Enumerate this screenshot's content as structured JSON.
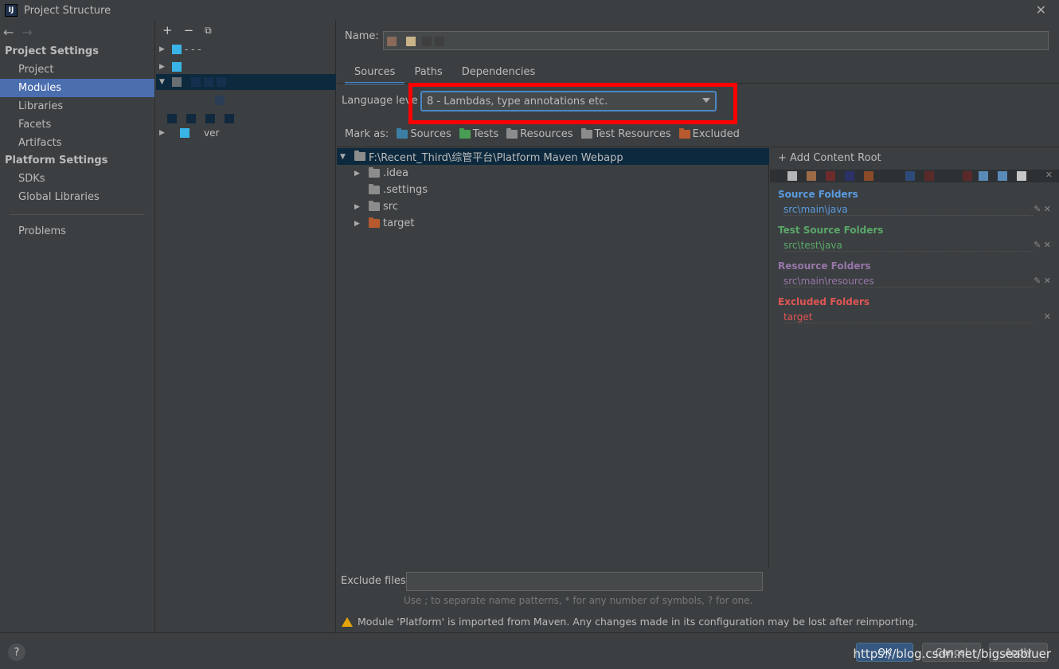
{
  "window": {
    "title": "Project Structure",
    "app_icon": "IJ"
  },
  "sidebar": {
    "back": "←",
    "forward": "→",
    "project_settings": "Project Settings",
    "project_items": [
      "Project",
      "Modules",
      "Libraries",
      "Facets",
      "Artifacts"
    ],
    "platform_settings": "Platform Settings",
    "platform_items": [
      "SDKs",
      "Global Libraries"
    ],
    "problems": "Problems",
    "selected": "Modules"
  },
  "modules": {
    "add": "+",
    "remove": "−",
    "copy": "⧉",
    "visible_text": [
      "- - -",
      "ver"
    ]
  },
  "name": {
    "label": "Name:",
    "value": ""
  },
  "tabs": [
    "Sources",
    "Paths",
    "Dependencies"
  ],
  "active_tab": "Sources",
  "language_level": {
    "label": "Language leve",
    "value": "8 - Lambdas, type annotations etc."
  },
  "mark_as": {
    "label": "Mark as:",
    "buttons": [
      {
        "label": "Sources",
        "color": "#3d7fa4"
      },
      {
        "label": "Tests",
        "color": "#499c54"
      },
      {
        "label": "Resources",
        "color": "#8c8c8c"
      },
      {
        "label": "Test Resources",
        "color": "#8c8c8c"
      },
      {
        "label": "Excluded",
        "color": "#b75a2d"
      }
    ]
  },
  "tree": {
    "root": "F:\\Recent_Third\\综管平台\\Platform Maven Webapp",
    "children": [
      {
        "name": ".idea",
        "expandable": true,
        "color": "#8c8c8c"
      },
      {
        "name": ".settings",
        "expandable": false,
        "color": "#8c8c8c"
      },
      {
        "name": "src",
        "expandable": true,
        "color": "#8c8c8c"
      },
      {
        "name": "target",
        "expandable": true,
        "color": "#b75a2d"
      }
    ]
  },
  "content_roots": {
    "add_label": "Add Content Root",
    "source_folders": {
      "title": "Source Folders",
      "color": "#5a9be0",
      "items": [
        "src\\main\\java"
      ]
    },
    "test_source_folders": {
      "title": "Test Source Folders",
      "color": "#59a869",
      "items": [
        "src\\test\\java"
      ]
    },
    "resource_folders": {
      "title": "Resource Folders",
      "color": "#9876aa",
      "items": [
        "src\\main\\resources"
      ]
    },
    "excluded_folders": {
      "title": "Excluded Folders",
      "color": "#e05555",
      "items": [
        "target"
      ]
    }
  },
  "exclude_files": {
    "label": "Exclude files:",
    "value": "",
    "hint": "Use ; to separate name patterns, * for any number of symbols, ? for one."
  },
  "warning": "Module 'Platform' is imported from Maven. Any changes made in its configuration may be lost after reimporting.",
  "footer": {
    "help": "?",
    "ok": "OK",
    "cancel": "Cancel",
    "apply": "Apply",
    "watermark": "https://blog.csdn.net/bigseabluer"
  }
}
